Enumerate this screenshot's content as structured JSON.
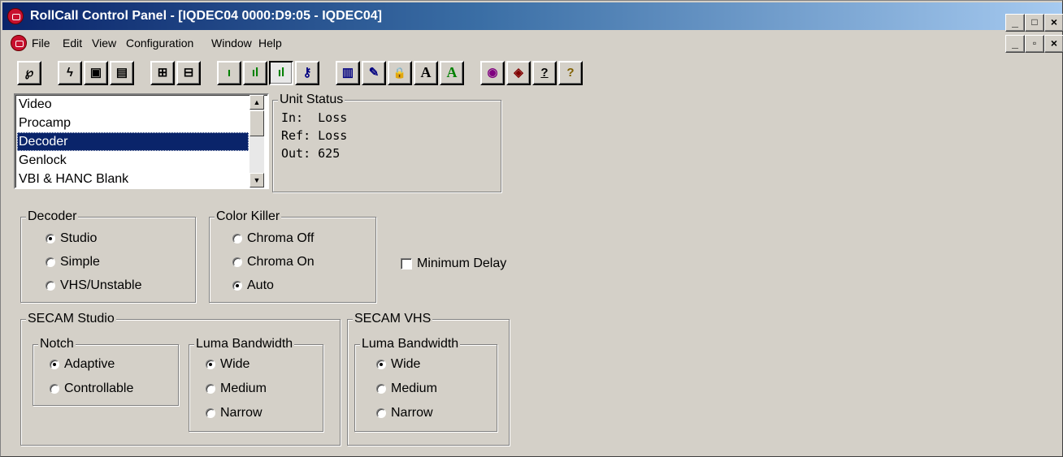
{
  "window": {
    "title": "RollCall Control Panel - [IQDEC04 0000:D9:05 - IQDEC04]",
    "caption_buttons": [
      "_",
      "□",
      "×"
    ],
    "mdi_buttons": [
      "_",
      "▫",
      "×"
    ]
  },
  "menu": [
    "File",
    "Edit",
    "View",
    "Configuration",
    "Window",
    "Help"
  ],
  "toolbar": {
    "buttons": [
      {
        "icon": "connect-icon",
        "glyph": "℘"
      },
      {
        "icon": "lightning-icon",
        "glyph": "ϟ"
      },
      {
        "icon": "save-icon",
        "glyph": "▣"
      },
      {
        "icon": "save-all-icon",
        "glyph": "▤"
      },
      {
        "icon": "network-icon",
        "glyph": "⊞"
      },
      {
        "icon": "page-icon",
        "glyph": "⊟"
      },
      {
        "icon": "level-low-icon",
        "glyph": "ı"
      },
      {
        "icon": "level-medium-icon",
        "glyph": "ıl"
      },
      {
        "icon": "level-high-icon",
        "glyph": "ıl"
      },
      {
        "icon": "key-icon",
        "glyph": "⚷"
      },
      {
        "icon": "book-icon",
        "glyph": "▥"
      },
      {
        "icon": "edit-icon",
        "glyph": "✎"
      },
      {
        "icon": "lock-icon",
        "glyph": "🔒"
      },
      {
        "icon": "font-black-icon",
        "glyph": "A"
      },
      {
        "icon": "font-green-icon",
        "glyph": "A"
      },
      {
        "icon": "search-globe-icon",
        "glyph": "◉"
      },
      {
        "icon": "disk-icon",
        "glyph": "◈"
      },
      {
        "icon": "help-index-icon",
        "glyph": "?"
      },
      {
        "icon": "help-icon",
        "glyph": "?"
      }
    ]
  },
  "list": {
    "items": [
      "Video",
      "Procamp",
      "Decoder",
      "Genlock",
      "VBI & HANC Blank"
    ],
    "selected": "Decoder"
  },
  "unit_status": {
    "title": "Unit Status",
    "lines": [
      "In:  Loss",
      "Ref: Loss",
      "Out: 625"
    ]
  },
  "decoder": {
    "title": "Decoder",
    "options": [
      "Studio",
      "Simple",
      "VHS/Unstable"
    ],
    "selected": "Studio"
  },
  "color_killer": {
    "title": "Color Killer",
    "options": [
      "Chroma Off",
      "Chroma On",
      "Auto"
    ],
    "selected": "Auto"
  },
  "minimum_delay": {
    "label": "Minimum Delay",
    "checked": false
  },
  "secam_studio": {
    "title": "SECAM Studio",
    "notch": {
      "title": "Notch",
      "options": [
        "Adaptive",
        "Controllable"
      ],
      "selected": "Adaptive"
    },
    "luma": {
      "title": "Luma Bandwidth",
      "options": [
        "Wide",
        "Medium",
        "Narrow"
      ],
      "selected": "Wide"
    }
  },
  "secam_vhs": {
    "title": "SECAM VHS",
    "luma": {
      "title": "Luma Bandwidth",
      "options": [
        "Wide",
        "Medium",
        "Narrow"
      ],
      "selected": "Wide"
    }
  },
  "colors": {
    "title_start": "#0a246a",
    "title_end": "#a6caf0",
    "face": "#d4d0c8",
    "selection": "#0a246a",
    "accent_green": "#008000"
  }
}
